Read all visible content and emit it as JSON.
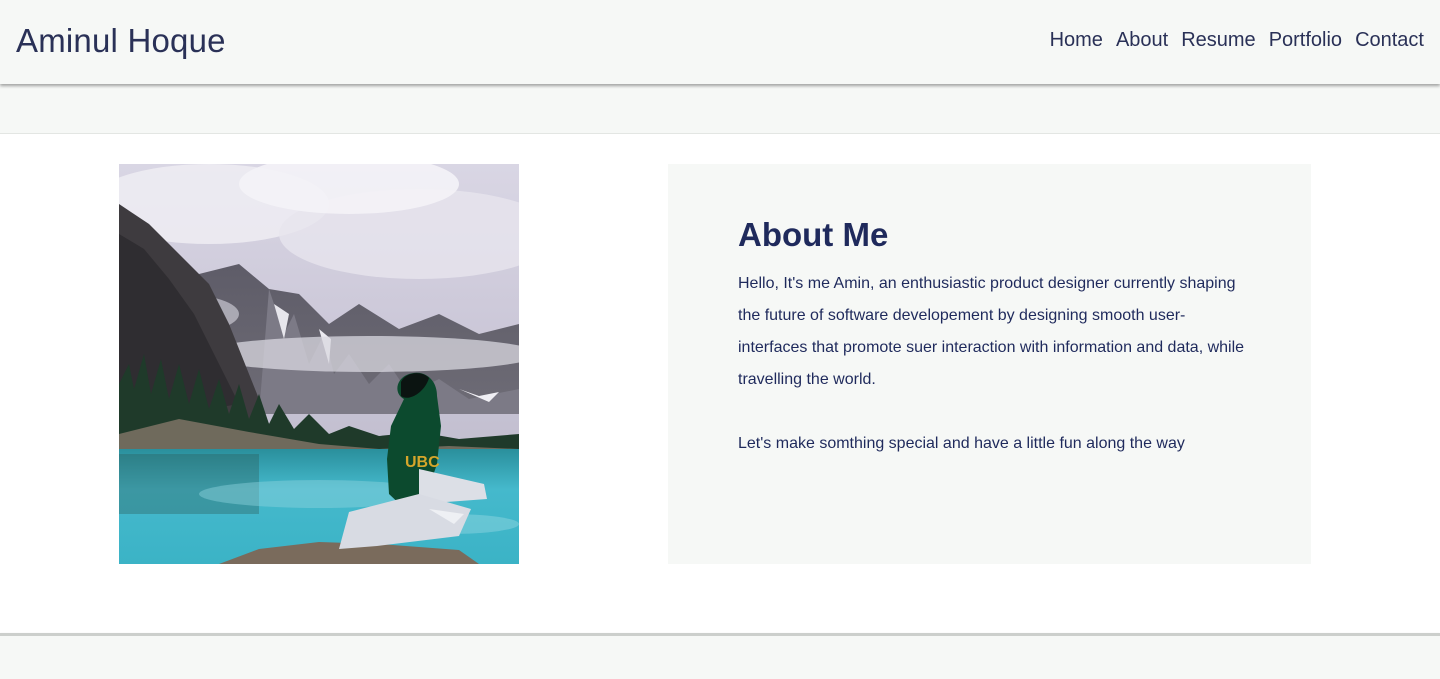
{
  "header": {
    "brand": "Aminul Hoque",
    "nav": [
      "Home",
      "About",
      "Resume",
      "Portfolio",
      "Contact"
    ]
  },
  "about": {
    "title": "About Me",
    "paragraphs": [
      "Hello, It's me Amin, an enthusiastic product designer currently shaping the future of software developement by designing smooth user-interfaces that promote suer interaction with information and data, while travelling the world.",
      "Let's make somthing special and have a little fun along the way"
    ],
    "photo": {
      "subject": "person in green hoodie sitting by mountain lake",
      "hoodie_text": "UBC"
    }
  },
  "colors": {
    "background": "#f6f8f6",
    "text": "#1f2a5c",
    "hoodie": "#0c4a2e",
    "lake": "#3bb3c6"
  }
}
